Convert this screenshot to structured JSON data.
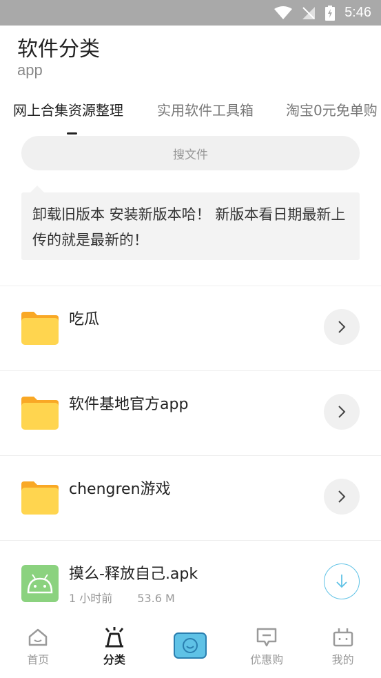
{
  "status_bar": {
    "time": "5:46"
  },
  "header": {
    "title": "软件分类",
    "subtitle": "app"
  },
  "tabs": [
    {
      "label": "网上合集资源整理",
      "active": true
    },
    {
      "label": "实用软件工具箱",
      "active": false
    },
    {
      "label": "淘宝0元免单购",
      "active": false
    }
  ],
  "search": {
    "placeholder": "搜文件"
  },
  "notice": {
    "text": "卸载旧版本 安装新版本哈！ 新版本看日期最新上传的就是最新的！"
  },
  "files": [
    {
      "name": "吃瓜",
      "type": "folder"
    },
    {
      "name": "软件基地官方app",
      "type": "folder"
    },
    {
      "name": "chengren游戏",
      "type": "folder"
    },
    {
      "name": "摸么-释放自己.apk",
      "type": "apk",
      "time": "1 小时前",
      "size": "53.6 M"
    }
  ],
  "bottom_nav": [
    {
      "label": "首页",
      "icon": "home-icon",
      "active": false
    },
    {
      "label": "分类",
      "icon": "category-icon",
      "active": true
    },
    {
      "label": "",
      "icon": "chat-bubble-icon",
      "active": false
    },
    {
      "label": "优惠购",
      "icon": "coupon-icon",
      "active": false
    },
    {
      "label": "我的",
      "icon": "robot-profile-icon",
      "active": false
    }
  ],
  "colors": {
    "accent": "#5fc2e6",
    "folder": "#ffd54f",
    "folder_tab": "#f9a825",
    "apk_green": "#8bd27f"
  }
}
